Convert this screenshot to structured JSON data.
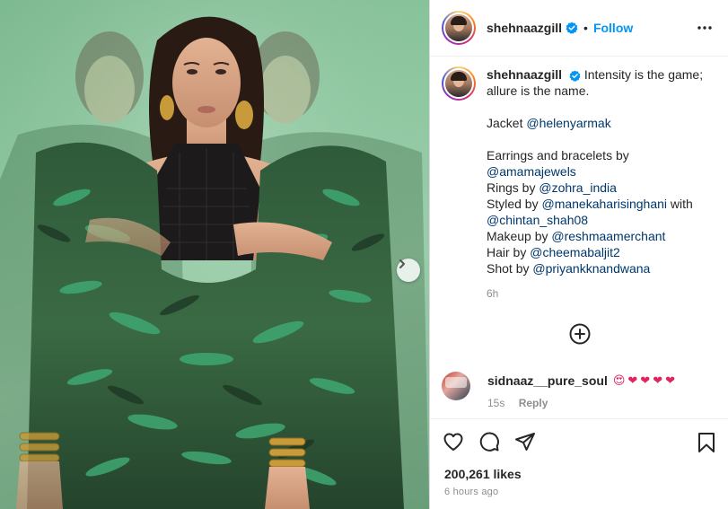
{
  "post": {
    "username": "shehnaazgill",
    "follow_label": "Follow",
    "separator": "•",
    "caption": {
      "line1": "Intensity is the game; allure is the name.",
      "jacket_prefix": "Jacket ",
      "jacket_mention": "@helenyarmak",
      "earrings_prefix": "Earrings and bracelets by",
      "earrings_mention": "@amamajewels",
      "rings_prefix": "Rings by ",
      "rings_mention": "@zohra_india",
      "styled_prefix": "Styled by ",
      "styled_mention": "@manekaharisinghani",
      "styled_with": " with",
      "styled_mention2": "@chintan_shah08",
      "makeup_prefix": "Makeup by ",
      "makeup_mention": "@reshmaamerchant",
      "hair_prefix": "Hair by ",
      "hair_mention": "@cheemabaljit2",
      "shot_prefix": "Shot by ",
      "shot_mention": "@priyankknandwana"
    },
    "caption_time": "6h",
    "likes": "200,261 likes",
    "posted_ago": "6 hours ago"
  },
  "comment": {
    "username": "sidnaaz__pure_soul",
    "emojis": [
      "😍",
      "❤",
      "❤",
      "❤",
      "❤"
    ],
    "time": "15s",
    "reply_label": "Reply"
  },
  "icons": {
    "verified": "verified-badge-icon",
    "more": "more-options-icon",
    "next": "chevron-right-icon",
    "load_more": "plus-circle-icon",
    "like": "heart-icon",
    "comment": "comment-icon",
    "share": "share-icon",
    "save": "bookmark-icon"
  },
  "colors": {
    "link_blue": "#0095f6",
    "mention": "#00376b",
    "photo_background": "#8ec8a0",
    "heart_red": "#e0245e"
  }
}
